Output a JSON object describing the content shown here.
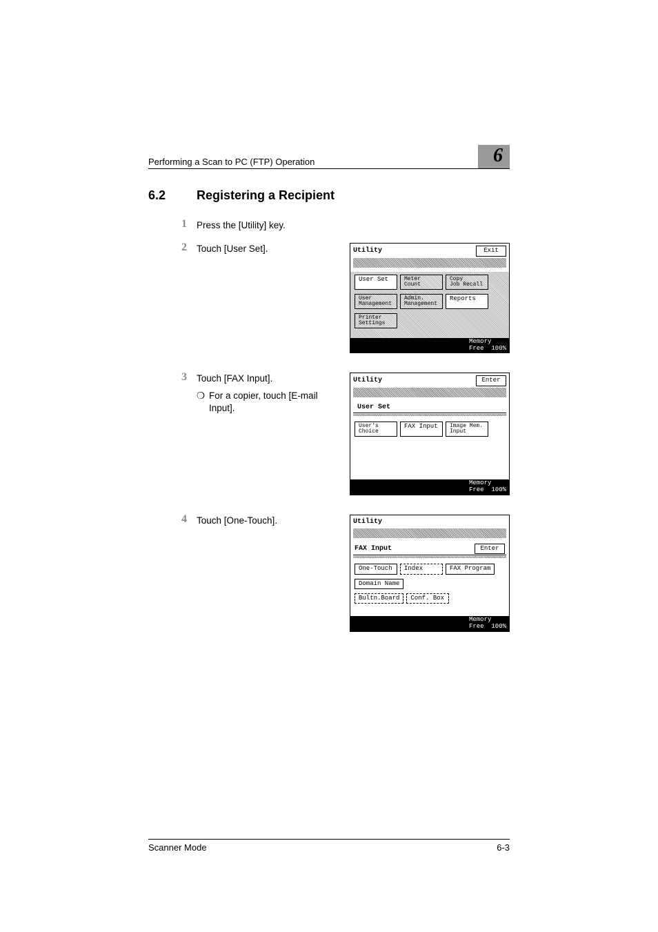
{
  "runningHead": "Performing a Scan to PC (FTP) Operation",
  "chapterNumber": "6",
  "section": {
    "number": "6.2",
    "title": "Registering a Recipient"
  },
  "steps": {
    "s1": {
      "num": "1",
      "text": "Press the [Utility] key."
    },
    "s2": {
      "num": "2",
      "text": "Touch [User Set]."
    },
    "s3": {
      "num": "3",
      "text": "Touch [FAX Input].",
      "bullet": "For a copier, touch [E-mail Input]."
    },
    "s4": {
      "num": "4",
      "text": "Touch [One-Touch]."
    }
  },
  "lcd1": {
    "title": "Utility",
    "exit": "Exit",
    "row1": {
      "a": "User Set",
      "b": "Meter\nCount",
      "c": "Copy\nJob Recall"
    },
    "row2": {
      "a": "User\nManagement",
      "b": "Admin.\nManagement",
      "c": "Reports"
    },
    "row3": {
      "a": "Printer\nSettings"
    },
    "memLabel": "Memory\nFree",
    "memValue": "100%"
  },
  "lcd2": {
    "title": "Utility",
    "enter": "Enter",
    "section": "User Set",
    "row1": {
      "a": "User's\nChoice",
      "b": "FAX Input",
      "c": "Image Mem.\nInput"
    },
    "memLabel": "Memory\nFree",
    "memValue": "100%"
  },
  "lcd3": {
    "title": "Utility",
    "section": "FAX Input",
    "enter": "Enter",
    "row1": {
      "a": "One-Touch",
      "b": "Index",
      "c": "FAX Program"
    },
    "row2": {
      "a": "Domain Name"
    },
    "row3": {
      "a": "Bultn.Board",
      "b": "Conf. Box"
    },
    "memLabel": "Memory\nFree",
    "memValue": "100%"
  },
  "footer": {
    "left": "Scanner Mode",
    "right": "6-3"
  }
}
